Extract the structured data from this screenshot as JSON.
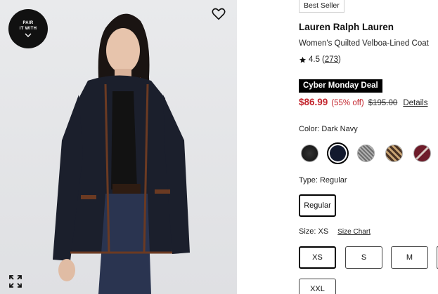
{
  "image": {
    "pair_badge": "PAIR IT WITH",
    "pair_line1": "PAIR",
    "pair_line2": "IT WITH"
  },
  "product": {
    "badge": "Best Seller",
    "brand": "Lauren Ralph Lauren",
    "name": "Women's Quilted Velboa-Lined Coat",
    "rating": "4.5",
    "review_count": "273",
    "deal": "Cyber Monday Deal",
    "price": "$86.99",
    "discount": "(55% off)",
    "original_price": "$195.00",
    "details_link": "Details"
  },
  "color": {
    "label": "Color: Dark Navy",
    "swatches": [
      {
        "name": "Black",
        "color": "#1c1c1c",
        "selected": false
      },
      {
        "name": "Dark Navy",
        "color": "#131a2e",
        "selected": true
      },
      {
        "name": "Grey Tweed",
        "color": "#8a8a8a",
        "selected": false
      },
      {
        "name": "Brown Houndstooth",
        "color": "#7b5a3a",
        "selected": false
      },
      {
        "name": "Burgundy",
        "color": "#6e1c2a",
        "selected": false
      }
    ]
  },
  "type": {
    "label": "Type: Regular",
    "option": "Regular"
  },
  "size": {
    "label": "Size: XS",
    "chart_link": "Size Chart",
    "options": [
      "XS",
      "S",
      "M",
      "XXL"
    ],
    "selected": "XS"
  },
  "colors": {
    "sale_red": "#c3262e",
    "black": "#000000"
  }
}
